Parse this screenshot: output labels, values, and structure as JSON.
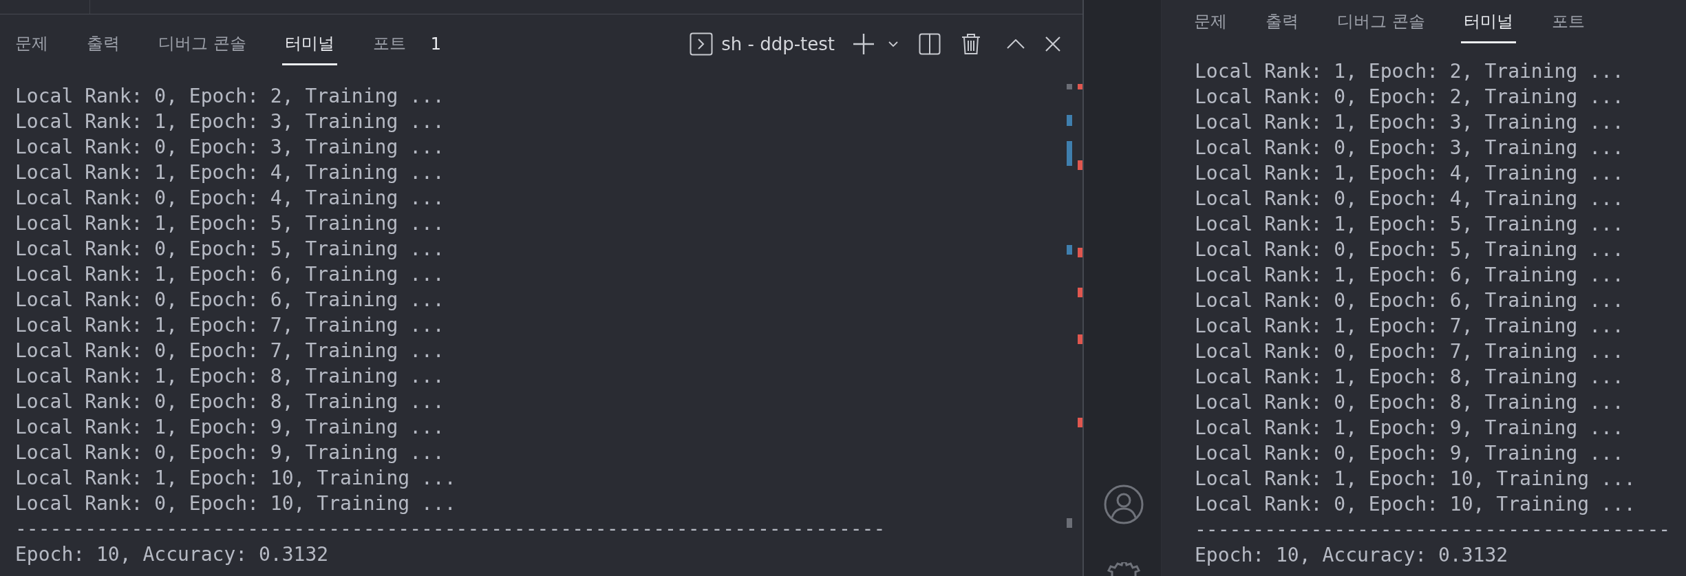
{
  "panels": [
    {
      "tabs": [
        {
          "label": "문제",
          "selected": false
        },
        {
          "label": "출력",
          "selected": false
        },
        {
          "label": "디버그 콘솔",
          "selected": false
        },
        {
          "label": "터미널",
          "selected": true
        },
        {
          "label": "포트",
          "selected": false
        }
      ],
      "badge": "1",
      "terminal_title": "sh - ddp-test",
      "lines": [
        "Local Rank: 0, Epoch: 2, Training ...",
        "Local Rank: 1, Epoch: 3, Training ...",
        "Local Rank: 0, Epoch: 3, Training ...",
        "Local Rank: 1, Epoch: 4, Training ...",
        "Local Rank: 0, Epoch: 4, Training ...",
        "Local Rank: 1, Epoch: 5, Training ...",
        "Local Rank: 0, Epoch: 5, Training ...",
        "Local Rank: 1, Epoch: 6, Training ...",
        "Local Rank: 0, Epoch: 6, Training ...",
        "Local Rank: 1, Epoch: 7, Training ...",
        "Local Rank: 0, Epoch: 7, Training ...",
        "Local Rank: 1, Epoch: 8, Training ...",
        "Local Rank: 0, Epoch: 8, Training ...",
        "Local Rank: 1, Epoch: 9, Training ...",
        "Local Rank: 0, Epoch: 9, Training ...",
        "Local Rank: 1, Epoch: 10, Training ...",
        "Local Rank: 0, Epoch: 10, Training ...",
        "---------------------------------------------------------------------------",
        "Epoch: 10, Accuracy: 0.3132"
      ]
    },
    {
      "tabs": [
        {
          "label": "문제",
          "selected": false
        },
        {
          "label": "출력",
          "selected": false
        },
        {
          "label": "디버그 콘솔",
          "selected": false
        },
        {
          "label": "터미널",
          "selected": true
        },
        {
          "label": "포트",
          "selected": false
        }
      ],
      "lines": [
        "Local Rank: 1, Epoch: 2, Training ...",
        "Local Rank: 0, Epoch: 2, Training ...",
        "Local Rank: 1, Epoch: 3, Training ...",
        "Local Rank: 0, Epoch: 3, Training ...",
        "Local Rank: 1, Epoch: 4, Training ...",
        "Local Rank: 0, Epoch: 4, Training ...",
        "Local Rank: 1, Epoch: 5, Training ...",
        "Local Rank: 0, Epoch: 5, Training ...",
        "Local Rank: 1, Epoch: 6, Training ...",
        "Local Rank: 0, Epoch: 6, Training ...",
        "Local Rank: 1, Epoch: 7, Training ...",
        "Local Rank: 0, Epoch: 7, Training ...",
        "Local Rank: 1, Epoch: 8, Training ...",
        "Local Rank: 0, Epoch: 8, Training ...",
        "Local Rank: 1, Epoch: 9, Training ...",
        "Local Rank: 0, Epoch: 9, Training ...",
        "Local Rank: 1, Epoch: 10, Training ...",
        "Local Rank: 0, Epoch: 10, Training ...",
        "-----------------------------------------",
        "Epoch: 10, Accuracy: 0.3132"
      ]
    }
  ]
}
